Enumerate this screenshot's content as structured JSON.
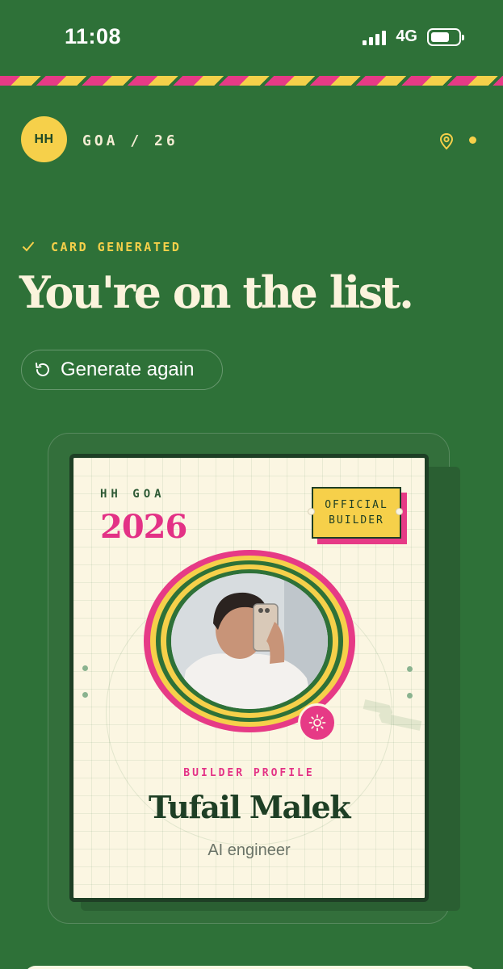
{
  "status_bar": {
    "time": "11:08",
    "network": "4G",
    "signal_bars": 4,
    "battery_level": 0.7
  },
  "header": {
    "avatar_initials": "HH",
    "location_label": "GOA / 26",
    "icons": [
      "map-pin-icon",
      "status-dot"
    ]
  },
  "confirmation": {
    "status_label": "CARD GENERATED",
    "headline": "You're on the list.",
    "regenerate_label": "Generate again"
  },
  "card": {
    "event_label": "HH GOA",
    "year": "2026",
    "badge_line1": "OFFICIAL",
    "badge_line2": "BUILDER",
    "section_label": "BUILDER PROFILE",
    "name": "Tufail Malek",
    "role": "AI engineer"
  },
  "colors": {
    "background": "#2e7138",
    "accent_yellow": "#f6d04a",
    "accent_pink": "#e63a86",
    "card_bg": "#fbf6e2",
    "dark_green": "#1e3f25"
  }
}
